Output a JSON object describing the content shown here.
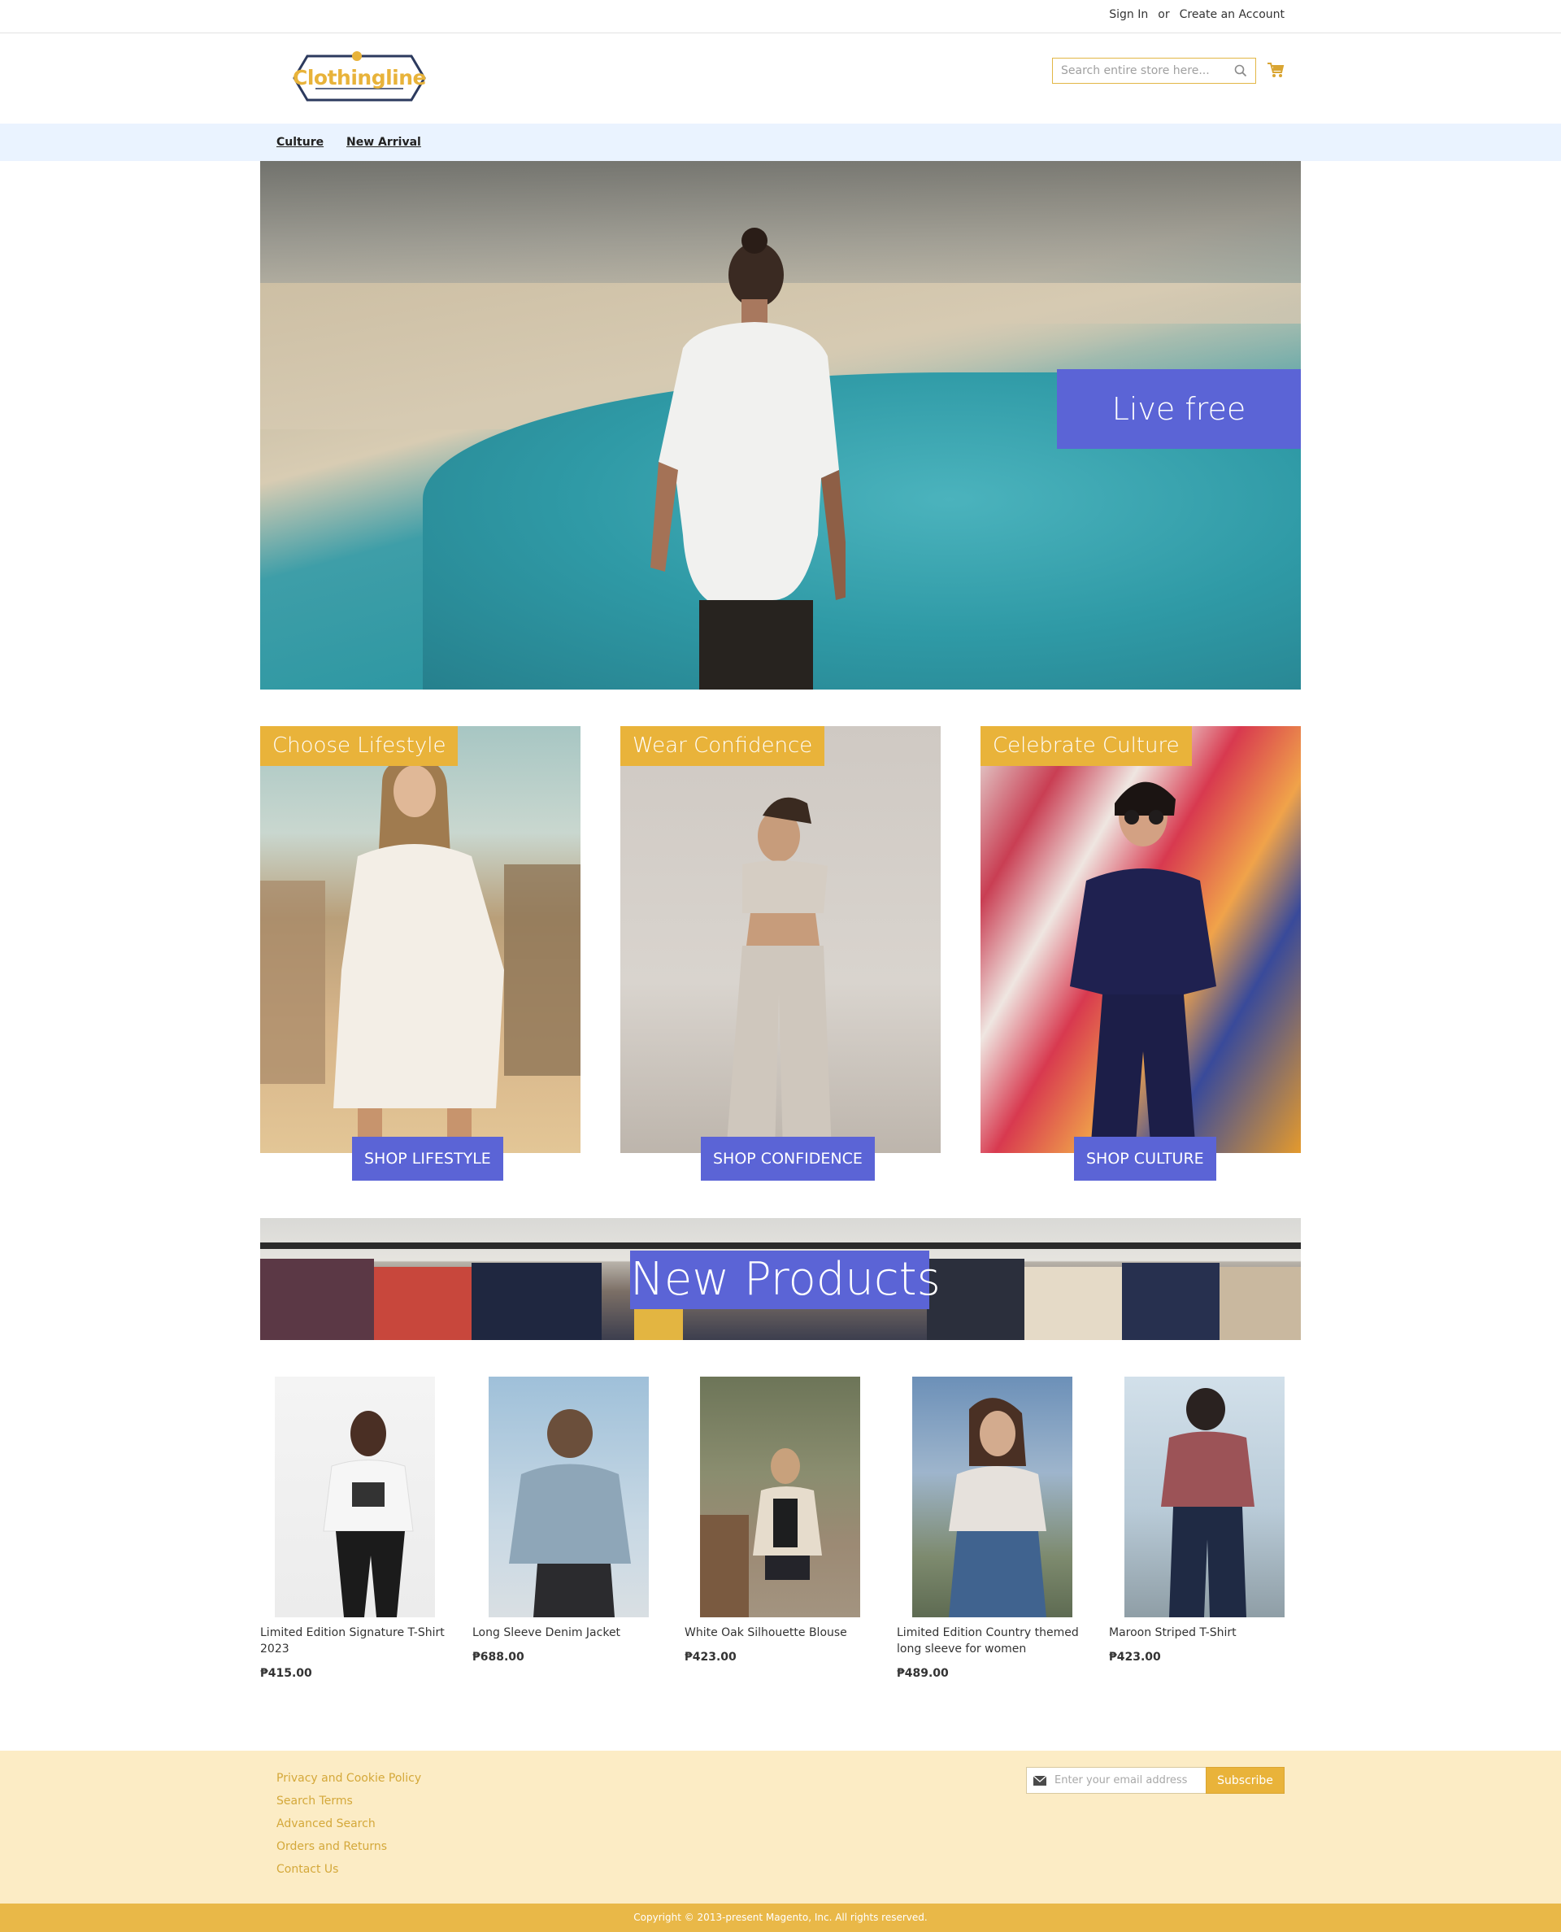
{
  "topbar": {
    "sign_in": "Sign In",
    "or": "or",
    "create_account": "Create an Account"
  },
  "header": {
    "logo_text": "Clothingline",
    "search_placeholder": "Search entire store here...",
    "search_icon": "search-icon",
    "cart_icon": "cart-icon"
  },
  "nav": {
    "items": [
      {
        "label": "Culture"
      },
      {
        "label": "New Arrival"
      }
    ]
  },
  "hero": {
    "badge": "Live free"
  },
  "tiles": [
    {
      "tag": "Choose Lifestyle",
      "button": "SHOP LIFESTYLE"
    },
    {
      "tag": "Wear Confidence",
      "button": "SHOP CONFIDENCE"
    },
    {
      "tag": "Celebrate Culture",
      "button": "SHOP CULTURE"
    }
  ],
  "new_products": {
    "title": "New Products",
    "items": [
      {
        "name": "Limited Edition Signature T-Shirt 2023",
        "price": "₱415.00"
      },
      {
        "name": "Long Sleeve Denim Jacket",
        "price": "₱688.00"
      },
      {
        "name": "White Oak Silhouette Blouse",
        "price": "₱423.00"
      },
      {
        "name": "Limited Edition Country themed long sleeve for women",
        "price": "₱489.00"
      },
      {
        "name": "Maroon Striped T-Shirt",
        "price": "₱423.00"
      }
    ]
  },
  "footer": {
    "links": [
      {
        "label": "Privacy and Cookie Policy"
      },
      {
        "label": "Search Terms"
      },
      {
        "label": "Advanced Search"
      },
      {
        "label": "Orders and Returns"
      },
      {
        "label": "Contact Us"
      }
    ],
    "newsletter_placeholder": "Enter your email address",
    "subscribe": "Subscribe",
    "copyright": "Copyright © 2013-present Magento, Inc. All rights reserved."
  },
  "colors": {
    "accent_blue": "#5b64d6",
    "accent_gold": "#e9b33a",
    "nav_bg": "#eaf3ff",
    "footer_bg": "#fcecc5"
  }
}
